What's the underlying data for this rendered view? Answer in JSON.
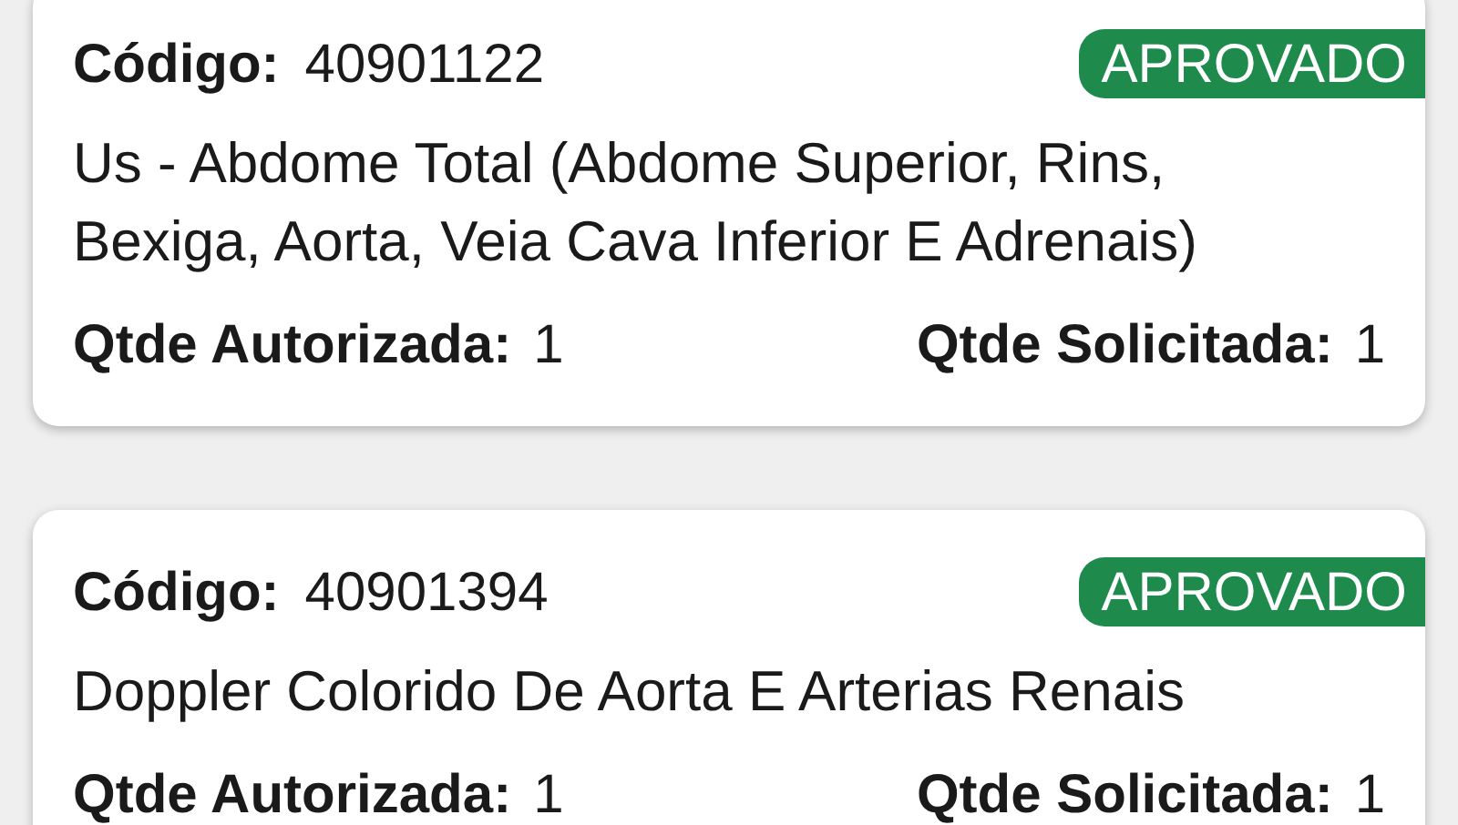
{
  "procedures": [
    {
      "code_label": "Código:",
      "code": "40901122",
      "status": {
        "label": "APROVADO",
        "color": "#1e8a4c"
      },
      "description": "Us - Abdome Total (Abdome Superior, Rins, Bexiga, Aorta, Veia Cava Inferior E Adrenais)",
      "authorized_label": "Qtde Autorizada:",
      "authorized": "1",
      "requested_label": "Qtde Solicitada:",
      "requested": "1"
    },
    {
      "code_label": "Código:",
      "code": "40901394",
      "status": {
        "label": "APROVADO",
        "color": "#1e8a4c"
      },
      "description": "Doppler Colorido De Aorta E Arterias Renais",
      "authorized_label": "Qtde Autorizada:",
      "authorized": "1",
      "requested_label": "Qtde Solicitada:",
      "requested": "1"
    }
  ]
}
